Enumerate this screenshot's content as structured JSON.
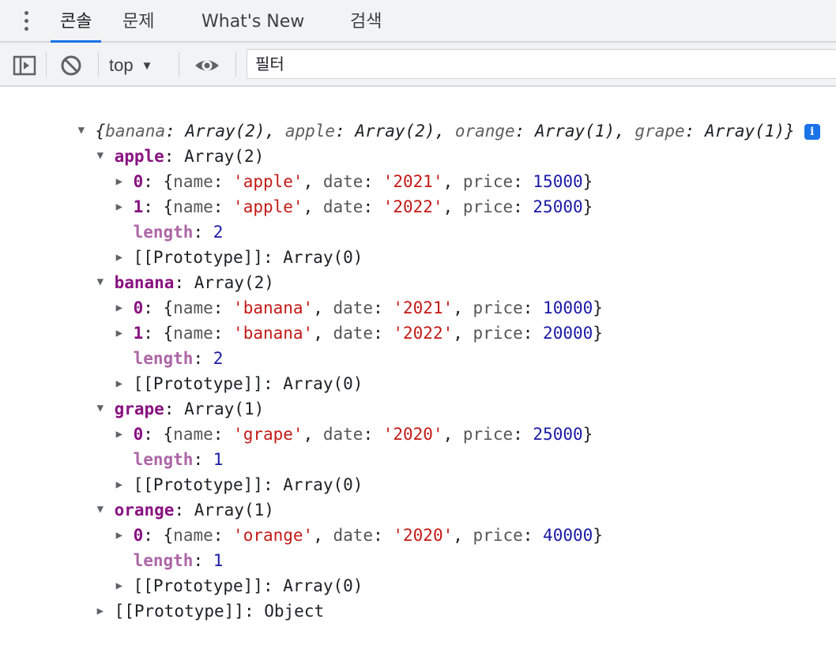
{
  "tabs": [
    {
      "label": "콘솔",
      "active": true
    },
    {
      "label": "문제",
      "active": false
    },
    {
      "label": "What's New",
      "active": false
    },
    {
      "label": "검색",
      "active": false
    }
  ],
  "toolbar": {
    "context": "top",
    "context_arrow": "▼",
    "filter_placeholder": "필터"
  },
  "icons": {
    "menu": "kebab-icon",
    "sidebar": "sidebar-toggle-icon",
    "clear": "clear-console-icon",
    "eye": "live-expression-eye-icon",
    "info": "info-icon"
  },
  "console": {
    "summary": {
      "open": "{",
      "entries": [
        {
          "key": "banana",
          "value": "Array(2)"
        },
        {
          "key": "apple",
          "value": "Array(2)"
        },
        {
          "key": "orange",
          "value": "Array(1)"
        },
        {
          "key": "grape",
          "value": "Array(1)"
        }
      ],
      "close": "}"
    },
    "groups": [
      {
        "key": "apple",
        "value": "Array(2)",
        "items": [
          {
            "index": "0",
            "name": "'apple'",
            "date": "'2021'",
            "price": "15000"
          },
          {
            "index": "1",
            "name": "'apple'",
            "date": "'2022'",
            "price": "25000"
          }
        ],
        "length": "2",
        "prototype": "Array(0)"
      },
      {
        "key": "banana",
        "value": "Array(2)",
        "items": [
          {
            "index": "0",
            "name": "'banana'",
            "date": "'2021'",
            "price": "10000"
          },
          {
            "index": "1",
            "name": "'banana'",
            "date": "'2022'",
            "price": "20000"
          }
        ],
        "length": "2",
        "prototype": "Array(0)"
      },
      {
        "key": "grape",
        "value": "Array(1)",
        "items": [
          {
            "index": "0",
            "name": "'grape'",
            "date": "'2020'",
            "price": "25000"
          }
        ],
        "length": "1",
        "prototype": "Array(0)"
      },
      {
        "key": "orange",
        "value": "Array(1)",
        "items": [
          {
            "index": "0",
            "name": "'orange'",
            "date": "'2020'",
            "price": "40000"
          }
        ],
        "length": "1",
        "prototype": "Array(0)"
      }
    ],
    "labels": {
      "length_key": "length",
      "prototype_key": "[[Prototype]]",
      "name_key": "name",
      "date_key": "date",
      "price_key": "price"
    },
    "root_prototype": "Object"
  },
  "colors": {
    "accent": "#1a73e8",
    "own_key": "#881280",
    "inherited_key": "#ad66a6",
    "string": "#c41a16",
    "number": "#1a1aa6"
  }
}
